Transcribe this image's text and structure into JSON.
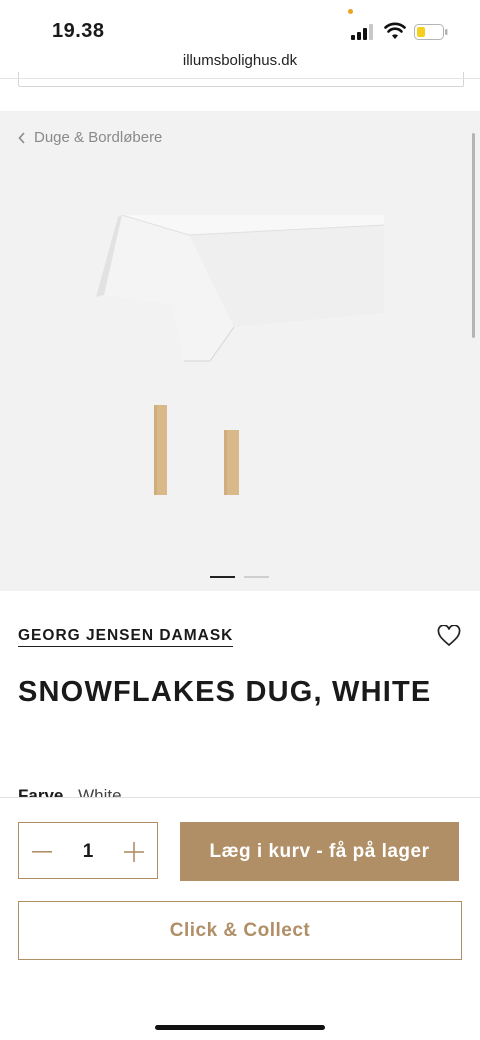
{
  "status_bar": {
    "time": "19.38",
    "url": "illumsbolighus.dk"
  },
  "breadcrumb": {
    "label": "Duge & Bordløbere"
  },
  "gallery": {
    "image_count": 2,
    "active_index": 1
  },
  "product": {
    "brand": "GEORG JENSEN DAMASK",
    "title": "SNOWFLAKES DUG, WHITE",
    "color_label": "Farve",
    "color_value": "White"
  },
  "cart": {
    "quantity": "1",
    "add_label": "Læg i kurv - få på lager",
    "collect_label": "Click & Collect"
  },
  "colors": {
    "accent": "#b08f66",
    "gallery_bg": "#f2f2f2",
    "text": "#1a1a1a"
  }
}
